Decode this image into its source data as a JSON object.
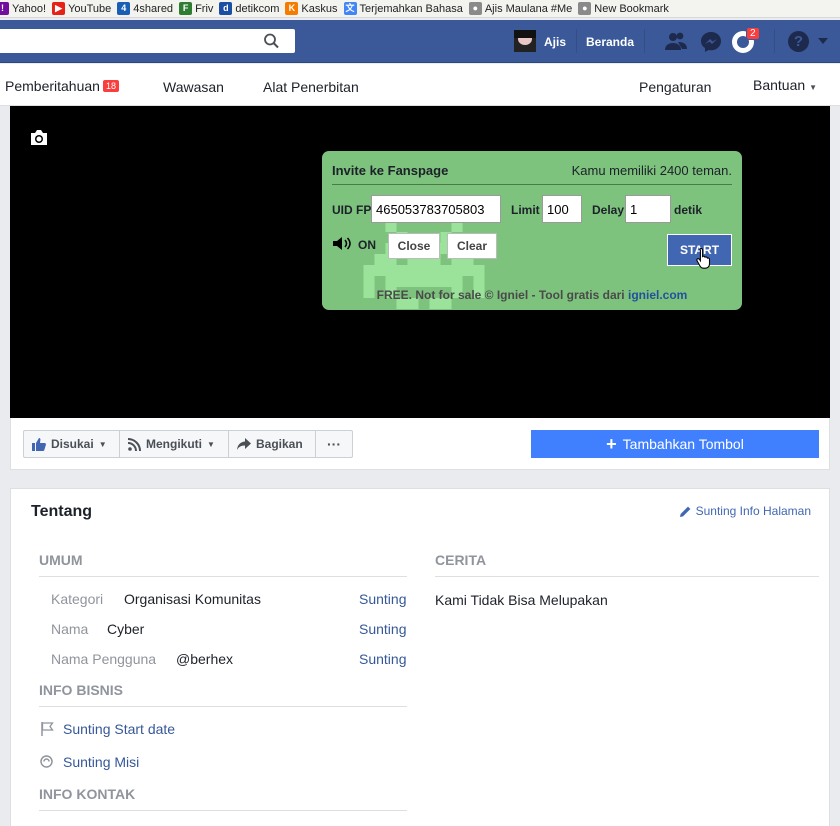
{
  "bookmarks": [
    {
      "label": "Yahoo!",
      "color": "#720e9e",
      "glyph": "!"
    },
    {
      "label": "YouTube",
      "color": "#e62117",
      "glyph": "▶"
    },
    {
      "label": "4shared",
      "color": "#1a5fb4",
      "glyph": "4"
    },
    {
      "label": "Friv",
      "color": "#2e7d32",
      "glyph": "F"
    },
    {
      "label": "detikcom",
      "color": "#1a4fa3",
      "glyph": "d"
    },
    {
      "label": "Kaskus",
      "color": "#f57c00",
      "glyph": "K"
    },
    {
      "label": "Terjemahkan Bahasa",
      "color": "#4285f4",
      "glyph": "文"
    },
    {
      "label": "Ajis Maulana #Me",
      "color": "#8a8a8a",
      "glyph": "●"
    },
    {
      "label": "New Bookmark",
      "color": "#8a8a8a",
      "glyph": "●"
    }
  ],
  "topnav": {
    "user": "Ajis",
    "home": "Beranda",
    "notif_count": "2"
  },
  "tabs": {
    "notifications": "Pemberitahuan",
    "notifications_badge": "18",
    "insights": "Wawasan",
    "publishing": "Alat Penerbitan",
    "settings": "Pengaturan",
    "help": "Bantuan"
  },
  "dialog": {
    "title": "Invite ke Fanspage",
    "friends": "Kamu memiliki 2400 teman.",
    "uid_label": "UID FP",
    "uid_value": "465053783705803",
    "limit_label": "Limit",
    "limit_value": "100",
    "delay_label": "Delay",
    "delay_value": "1",
    "delay_unit": "detik",
    "sound": "ON",
    "close": "Close",
    "clear": "Clear",
    "start": "START",
    "footer": "FREE. Not for sale © Igniel - Tool gratis dari ",
    "footer_link": "igniel.com"
  },
  "actions": {
    "like": "Disukai",
    "follow": "Mengikuti",
    "share": "Bagikan",
    "more": "···",
    "add_button": "Tambahkan Tombol"
  },
  "about": {
    "title": "Tentang",
    "edit_info": "Sunting Info Halaman",
    "general": {
      "heading": "UMUM",
      "rows": [
        {
          "label": "Kategori",
          "value": "Organisasi Komunitas",
          "edit": "Sunting"
        },
        {
          "label": "Nama",
          "value": "Cyber",
          "edit": "Sunting"
        },
        {
          "label": "Nama Pengguna",
          "value": "@berhex",
          "edit": "Sunting"
        }
      ]
    },
    "business": {
      "heading": "INFO BISNIS",
      "items": [
        "Sunting Start date",
        "Sunting Misi"
      ]
    },
    "contact": {
      "heading": "INFO KONTAK"
    },
    "story": {
      "heading": "CERITA",
      "text": "Kami Tidak Bisa Melupakan"
    }
  },
  "colors": {
    "fb_blue": "#3b5998",
    "dialog_green": "#7dc37d",
    "start_blue": "#4267b2",
    "add_button_blue": "#4080ff"
  }
}
